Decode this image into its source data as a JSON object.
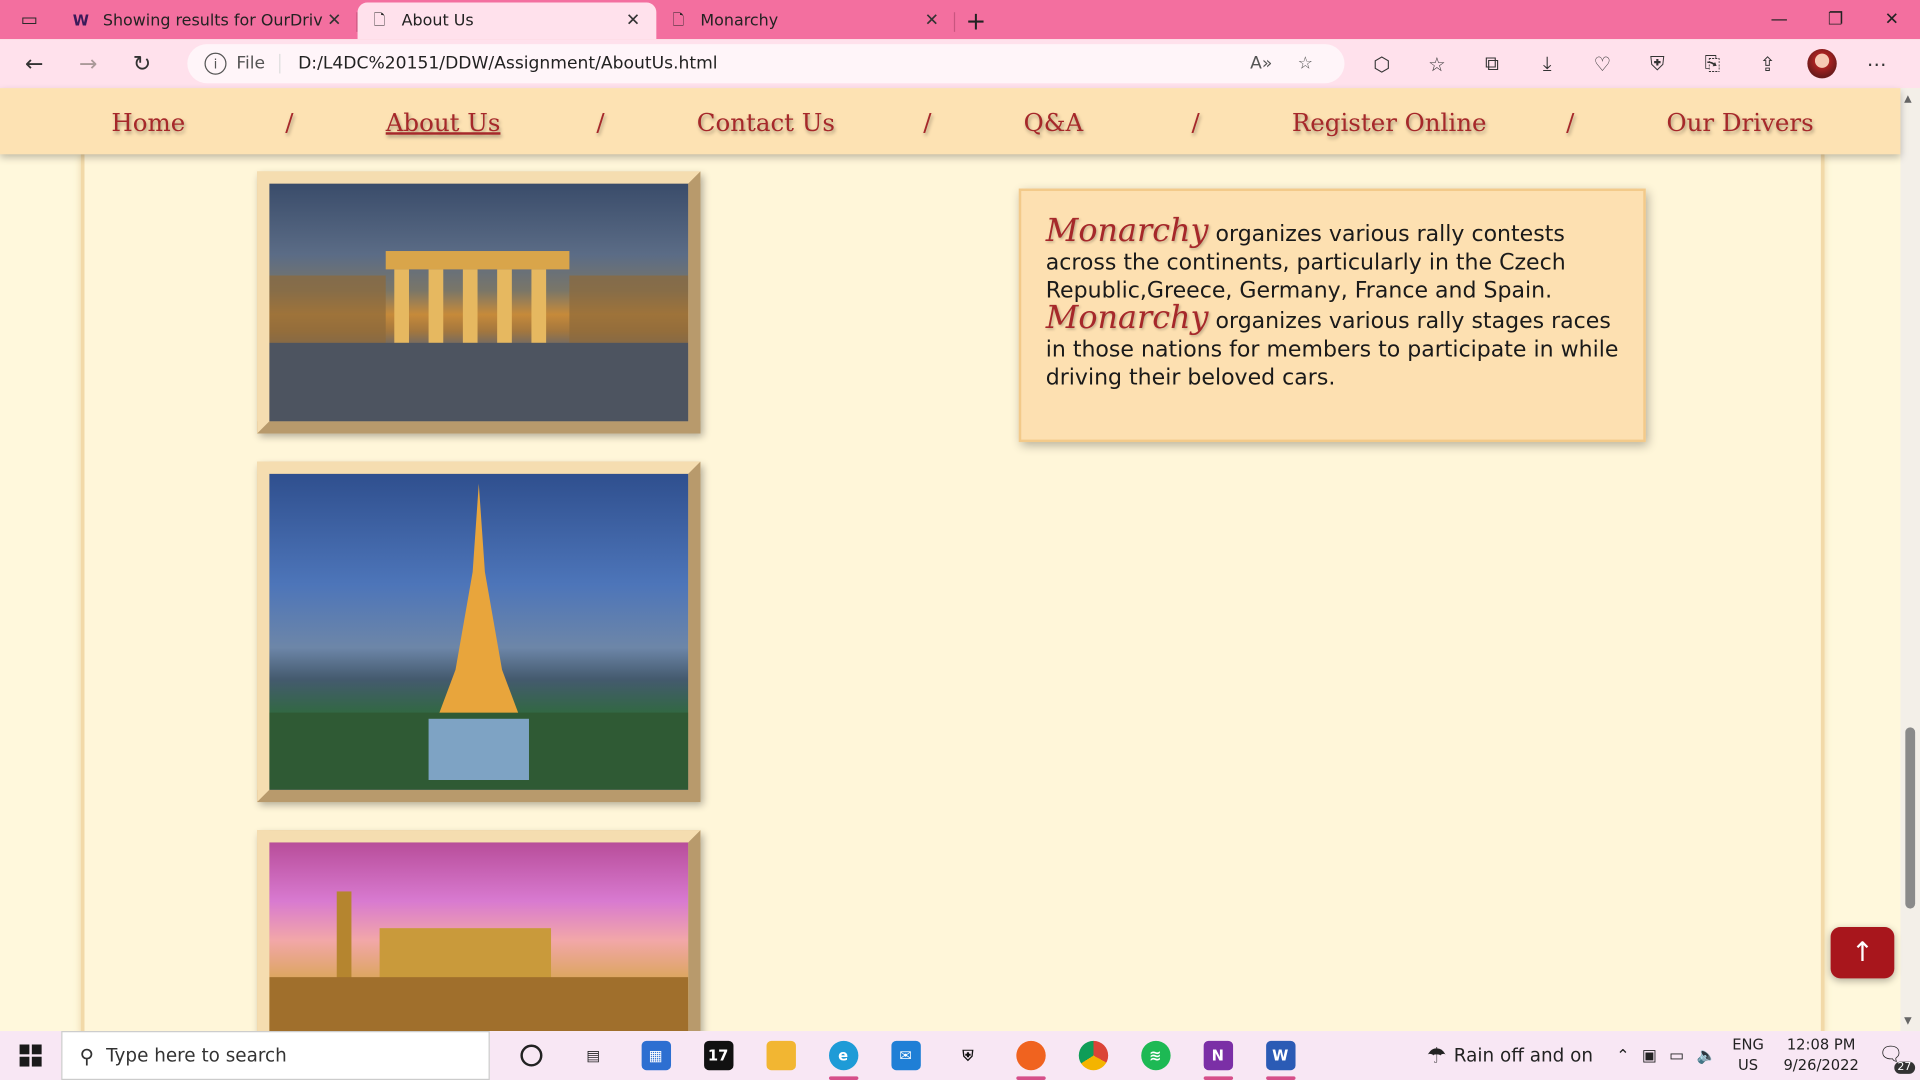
{
  "browser": {
    "tabs": [
      {
        "label": "Showing results for OurDrivers.h",
        "icon": "w3-icon",
        "active": false
      },
      {
        "label": "About Us",
        "icon": "page-icon",
        "active": true
      },
      {
        "label": "Monarchy",
        "icon": "page-icon",
        "active": false
      }
    ],
    "address": {
      "scheme_label": "File",
      "url": "D:/L4DC%20151/DDW/Assignment/AboutUs.html"
    }
  },
  "nav": {
    "items": [
      "Home",
      "About Us",
      "Contact Us",
      "Q&A",
      "Register Online",
      "Our Drivers"
    ],
    "current": "About Us",
    "separator": "/"
  },
  "info": {
    "brand": "Monarchy",
    "text1": " organizes various rally contests across the continents, particularly in the Czech Republic,Greece, Germany, France and Spain.",
    "text2": " organizes various rally stages races in those nations for members to participate in while driving their beloved cars."
  },
  "photos": [
    {
      "subject": "Brandenburg Gate at dusk"
    },
    {
      "subject": "Eiffel Tower at dusk"
    },
    {
      "subject": "Cordoba cityscape at sunset"
    }
  ],
  "back_to_top": {
    "icon": "arrow-up-icon"
  },
  "taskbar": {
    "search_placeholder": "Type here to search",
    "weather": "Rain off and on",
    "lang_line1": "ENG",
    "lang_line2": "US",
    "time": "12:08 PM",
    "date": "9/26/2022",
    "notif_count": "27"
  },
  "colors": {
    "tabbar": "#f36f9f",
    "nav_text": "#a6282a",
    "nav_bg": "#fde2b3",
    "page_bg": "#fff8dc"
  }
}
